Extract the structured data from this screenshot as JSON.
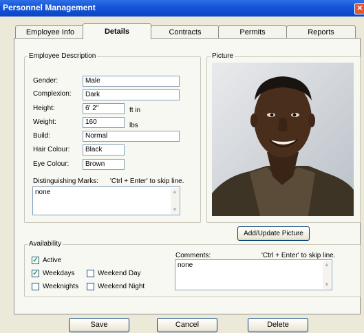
{
  "window": {
    "title": "Personnel Management"
  },
  "tabs": [
    {
      "label": "Employee Info"
    },
    {
      "label": "Details"
    },
    {
      "label": "Contracts"
    },
    {
      "label": "Permits"
    },
    {
      "label": "Reports"
    }
  ],
  "description": {
    "legend": "Employee Description",
    "gender": {
      "label": "Gender:",
      "value": "Male"
    },
    "complexion": {
      "label": "Complexion:",
      "value": "Dark"
    },
    "height": {
      "label": "Height:",
      "value": "6' 2\"",
      "unit": "ft in"
    },
    "weight": {
      "label": "Weight:",
      "value": "160",
      "unit": "lbs"
    },
    "build": {
      "label": "Build:",
      "value": "Normal"
    },
    "hair": {
      "label": "Hair Colour:",
      "value": "Black"
    },
    "eye": {
      "label": "Eye Colour:",
      "value": "Brown"
    },
    "marks": {
      "label": "Distinguishing Marks:",
      "hint": "'Ctrl + Enter' to skip line.",
      "value": "none"
    }
  },
  "picture": {
    "legend": "Picture",
    "button": "Add/Update Picture"
  },
  "availability": {
    "legend": "Availability",
    "active": {
      "label": "Active",
      "checked": true
    },
    "weekdays": {
      "label": "Weekdays",
      "checked": true
    },
    "weekend_day": {
      "label": "Weekend Day",
      "checked": false
    },
    "weeknights": {
      "label": "Weeknights",
      "checked": false
    },
    "weekend_night": {
      "label": "Weekend Night",
      "checked": false
    },
    "comments": {
      "label": "Comments:",
      "hint": "'Ctrl + Enter' to skip line.",
      "value": "none"
    }
  },
  "buttons": {
    "save": "Save",
    "cancel": "Cancel",
    "delete": "Delete"
  },
  "glyphs": {
    "close": "✕",
    "check": "✓",
    "up": "▲",
    "down": "▼"
  }
}
